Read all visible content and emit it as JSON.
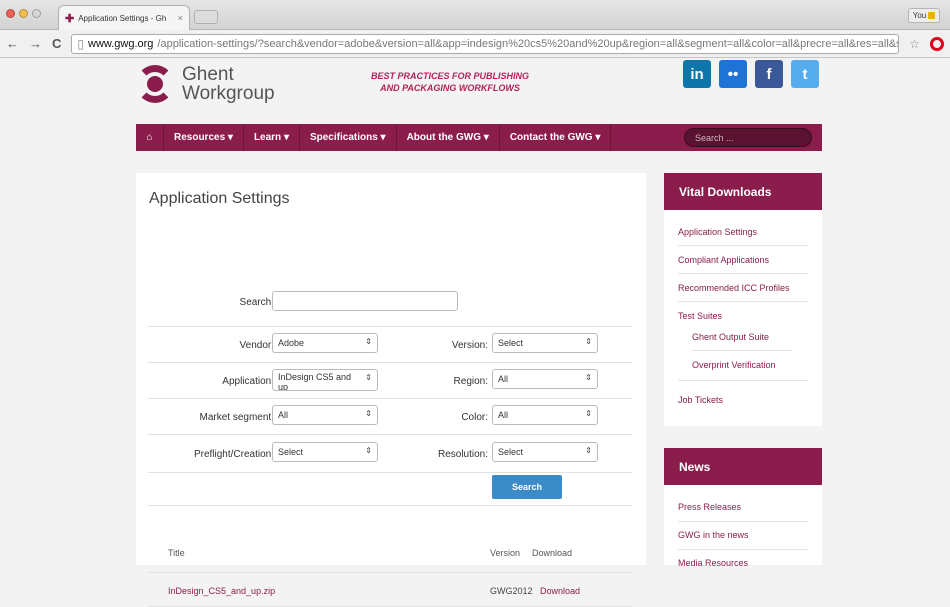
{
  "browser": {
    "tab_title": "Application Settings - Gh",
    "tab_close": "×",
    "profile_label": "You",
    "back": "←",
    "forward": "→",
    "reload": "C",
    "url_host": "www.gwg.org",
    "url_rest": "/application-settings/?search&vendor=adobe&version=all&app=indesign%20cs5%20and%20up&region=all&segment=all&color=all&precre=all&res=all&su...",
    "star": "☆"
  },
  "site": {
    "logo_line1": "Ghent",
    "logo_line2": "Workgroup",
    "tagline_line1": "BEST PRACTICES FOR PUBLISHING",
    "tagline_line2": "AND PACKAGING WORKFLOWS",
    "social": [
      {
        "label": "in",
        "color": "#0e76a8",
        "icon": "linkedin-icon"
      },
      {
        "label": "••",
        "color": "#1e74d6",
        "icon": "flickr-icon"
      },
      {
        "label": "f",
        "color": "#3b5998",
        "icon": "facebook-icon"
      },
      {
        "label": "t",
        "color": "#55acee",
        "icon": "twitter-icon"
      }
    ]
  },
  "menu": {
    "home_icon": "⌂",
    "items": [
      "Resources ▾",
      "Learn ▾",
      "Specifications ▾",
      "About the GWG ▾",
      "Contact the GWG ▾"
    ],
    "search_placeholder": "Search ..."
  },
  "form": {
    "title": "Application Settings",
    "search_label": "Search:",
    "search_value": "",
    "vendor_label": "Vendor:",
    "vendor_value": "Adobe",
    "version_label": "Version:",
    "version_value": "Select",
    "application_label": "Application:",
    "application_value": "InDesign CS5 and up",
    "region_label": "Region:",
    "region_value": "All",
    "segment_label": "Market segment:",
    "segment_value": "All",
    "color_label": "Color:",
    "color_value": "All",
    "preflight_label": "Preflight/Creation:",
    "preflight_value": "Select",
    "resolution_label": "Resolution:",
    "resolution_value": "Select",
    "search_button": "Search",
    "arrow": "⇕"
  },
  "results": {
    "headers": [
      "Title",
      "Version",
      "Download"
    ],
    "rows": [
      {
        "title": "InDesign_CS5_and_up.zip",
        "version": "GWG2012",
        "download": "Download"
      }
    ]
  },
  "sidebar": {
    "downloads_title": "Vital Downloads",
    "downloads": [
      "Application Settings",
      "Compliant Applications",
      "Recommended ICC Profiles",
      "Test Suites",
      "Ghent Output Suite",
      "Overprint Verification",
      "Job Tickets"
    ],
    "news_title": "News",
    "news": [
      "Press Releases",
      "GWG in the news",
      "Media Resources"
    ]
  },
  "colors": {
    "brand": "#8b1d4c",
    "button": "#3a8bc8"
  }
}
